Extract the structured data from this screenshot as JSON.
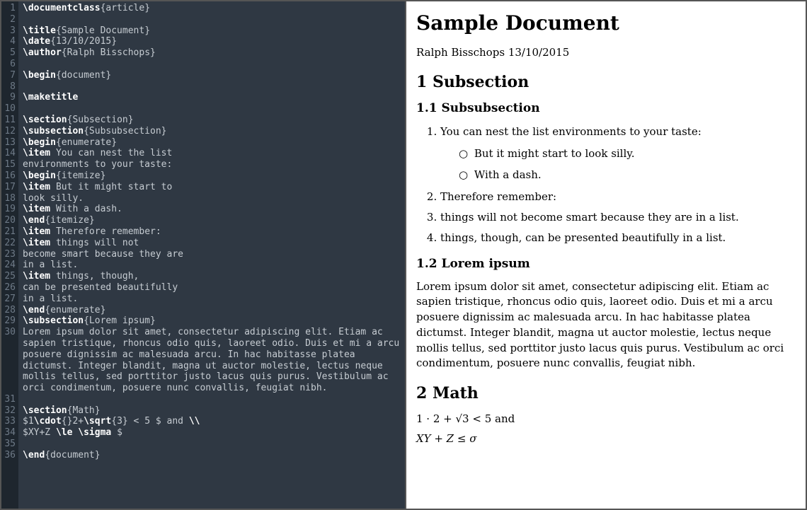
{
  "editor": {
    "lines": [
      {
        "n": 1,
        "segs": [
          {
            "t": "\\documentclass",
            "c": "cmd"
          },
          {
            "t": "{article}"
          }
        ]
      },
      {
        "n": 2,
        "segs": [
          {
            "t": ""
          }
        ]
      },
      {
        "n": 3,
        "segs": [
          {
            "t": "\\title",
            "c": "cmd"
          },
          {
            "t": "{Sample Document}"
          }
        ]
      },
      {
        "n": 4,
        "segs": [
          {
            "t": "\\date",
            "c": "cmd"
          },
          {
            "t": "{13/10/2015}"
          }
        ]
      },
      {
        "n": 5,
        "segs": [
          {
            "t": "\\author",
            "c": "cmd"
          },
          {
            "t": "{Ralph Bisschops}"
          }
        ]
      },
      {
        "n": 6,
        "segs": [
          {
            "t": ""
          }
        ]
      },
      {
        "n": 7,
        "segs": [
          {
            "t": "\\begin",
            "c": "cmd"
          },
          {
            "t": "{document}"
          }
        ]
      },
      {
        "n": 8,
        "segs": [
          {
            "t": ""
          }
        ]
      },
      {
        "n": 9,
        "segs": [
          {
            "t": "\\maketitle",
            "c": "cmd"
          }
        ]
      },
      {
        "n": 10,
        "segs": [
          {
            "t": ""
          }
        ]
      },
      {
        "n": 11,
        "segs": [
          {
            "t": "\\section",
            "c": "cmd"
          },
          {
            "t": "{Subsection}"
          }
        ]
      },
      {
        "n": 12,
        "segs": [
          {
            "t": "\\subsection",
            "c": "cmd"
          },
          {
            "t": "{Subsubsection}"
          }
        ]
      },
      {
        "n": 13,
        "segs": [
          {
            "t": "\\begin",
            "c": "cmd"
          },
          {
            "t": "{enumerate}"
          }
        ]
      },
      {
        "n": 14,
        "segs": [
          {
            "t": "\\item",
            "c": "cmd"
          },
          {
            "t": " You can nest the list"
          }
        ]
      },
      {
        "n": 15,
        "segs": [
          {
            "t": "environments to your taste:"
          }
        ]
      },
      {
        "n": 16,
        "segs": [
          {
            "t": "\\begin",
            "c": "cmd"
          },
          {
            "t": "{itemize}"
          }
        ]
      },
      {
        "n": 17,
        "segs": [
          {
            "t": "\\item",
            "c": "cmd"
          },
          {
            "t": " But it might start to"
          }
        ]
      },
      {
        "n": 18,
        "segs": [
          {
            "t": "look silly."
          }
        ]
      },
      {
        "n": 19,
        "segs": [
          {
            "t": "\\item",
            "c": "cmd"
          },
          {
            "t": " With a dash."
          }
        ]
      },
      {
        "n": 20,
        "segs": [
          {
            "t": "\\end",
            "c": "cmd"
          },
          {
            "t": "{itemize}"
          }
        ]
      },
      {
        "n": 21,
        "segs": [
          {
            "t": "\\item",
            "c": "cmd"
          },
          {
            "t": " Therefore remember:"
          }
        ]
      },
      {
        "n": 22,
        "segs": [
          {
            "t": "\\item",
            "c": "cmd"
          },
          {
            "t": " things will not"
          }
        ]
      },
      {
        "n": 23,
        "segs": [
          {
            "t": "become smart because they are"
          }
        ]
      },
      {
        "n": 24,
        "segs": [
          {
            "t": "in a list."
          }
        ]
      },
      {
        "n": 25,
        "segs": [
          {
            "t": "\\item",
            "c": "cmd"
          },
          {
            "t": " things, though,"
          }
        ]
      },
      {
        "n": 26,
        "segs": [
          {
            "t": "can be presented beautifully"
          }
        ]
      },
      {
        "n": 27,
        "segs": [
          {
            "t": "in a list."
          }
        ]
      },
      {
        "n": 28,
        "segs": [
          {
            "t": "\\end",
            "c": "cmd"
          },
          {
            "t": "{enumerate}"
          }
        ]
      },
      {
        "n": 29,
        "segs": [
          {
            "t": "\\subsection",
            "c": "cmd"
          },
          {
            "t": "{Lorem ipsum}"
          }
        ]
      },
      {
        "n": 30,
        "segs": [
          {
            "t": "Lorem ipsum dolor sit amet, consectetur adipiscing elit. Etiam ac sapien tristique, rhoncus odio quis, laoreet odio. Duis et mi a arcu posuere dignissim ac malesuada arcu. In hac habitasse platea dictumst. Integer blandit, magna ut auctor molestie, lectus neque mollis tellus, sed porttitor justo lacus quis purus. Vestibulum ac orci condimentum, posuere nunc convallis, feugiat nibh."
          }
        ]
      },
      {
        "n": 31,
        "segs": [
          {
            "t": ""
          }
        ]
      },
      {
        "n": 32,
        "segs": [
          {
            "t": "\\section",
            "c": "cmd"
          },
          {
            "t": "{Math}"
          }
        ]
      },
      {
        "n": 33,
        "segs": [
          {
            "t": "$1"
          },
          {
            "t": "\\cdot",
            "c": "cmd"
          },
          {
            "t": "{}2+"
          },
          {
            "t": "\\sqrt",
            "c": "cmd"
          },
          {
            "t": "{3} < 5 $ and "
          },
          {
            "t": "\\\\",
            "c": "cmd"
          }
        ]
      },
      {
        "n": 34,
        "segs": [
          {
            "t": "$XY+Z "
          },
          {
            "t": "\\le",
            "c": "cmd"
          },
          {
            "t": " "
          },
          {
            "t": "\\sigma",
            "c": "cmd"
          },
          {
            "t": " $"
          }
        ]
      },
      {
        "n": 35,
        "segs": [
          {
            "t": ""
          }
        ]
      },
      {
        "n": 36,
        "segs": [
          {
            "t": "\\end",
            "c": "cmd"
          },
          {
            "t": "{document}"
          }
        ]
      }
    ]
  },
  "preview": {
    "title": "Sample Document",
    "author": "Ralph Bisschops",
    "date": "13/10/2015",
    "sec1_heading": "1 Subsection",
    "sec1_1_heading": "1.1 Subsubsection",
    "enum": [
      "You can nest the list environments to your taste:",
      "Therefore remember:",
      "things will not become smart because they are in a list.",
      "things, though, can be presented beautifully in a list."
    ],
    "sublist": [
      "But it might start to look silly.",
      "With a dash."
    ],
    "sec1_2_heading": "1.2 Lorem ipsum",
    "lorem": "Lorem ipsum dolor sit amet, consectetur adipiscing elit. Etiam ac sapien tristique, rhoncus odio quis, laoreet odio. Duis et mi a arcu posuere dignissim ac malesuada arcu. In hac habitasse platea dictumst. Integer blandit, magna ut auctor molestie, lectus neque mollis tellus, sed porttitor justo lacus quis purus. Vestibulum ac orci condimentum, posuere nunc convallis, feugiat nibh.",
    "sec2_heading": "2 Math",
    "math1_pre": "1 · 2 + ",
    "math1_sqrt": "√3",
    "math1_post": " < 5 ",
    "math1_and": "and",
    "math2": "XY + Z ≤ σ"
  }
}
